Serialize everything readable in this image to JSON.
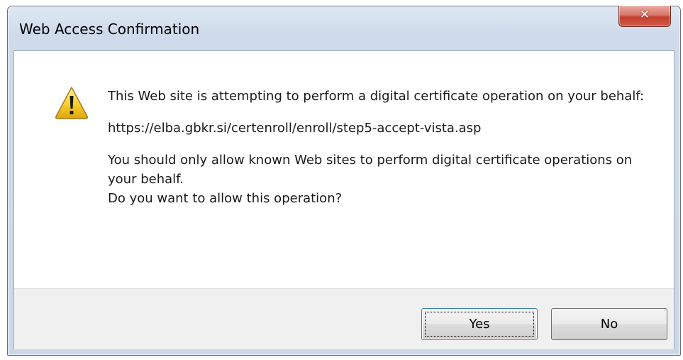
{
  "window": {
    "title": "Web Access Confirmation",
    "close_icon": "close-icon"
  },
  "dialog": {
    "icon": "warning-icon",
    "line1": "This Web site is attempting to perform a digital certificate operation on your behalf:",
    "url": "https://elba.gbkr.si/certenroll/enroll/step5-accept-vista.asp",
    "line3": "You should only allow known Web sites to perform digital certificate operations on your behalf.",
    "line4": "Do you want to allow this operation?"
  },
  "buttons": {
    "yes_label": "Yes",
    "no_label": "No"
  },
  "colors": {
    "titlebar": "#cbd8e8",
    "close_button": "#c4402e",
    "footer": "#f0f0f0",
    "warning": "#f2c21a"
  }
}
